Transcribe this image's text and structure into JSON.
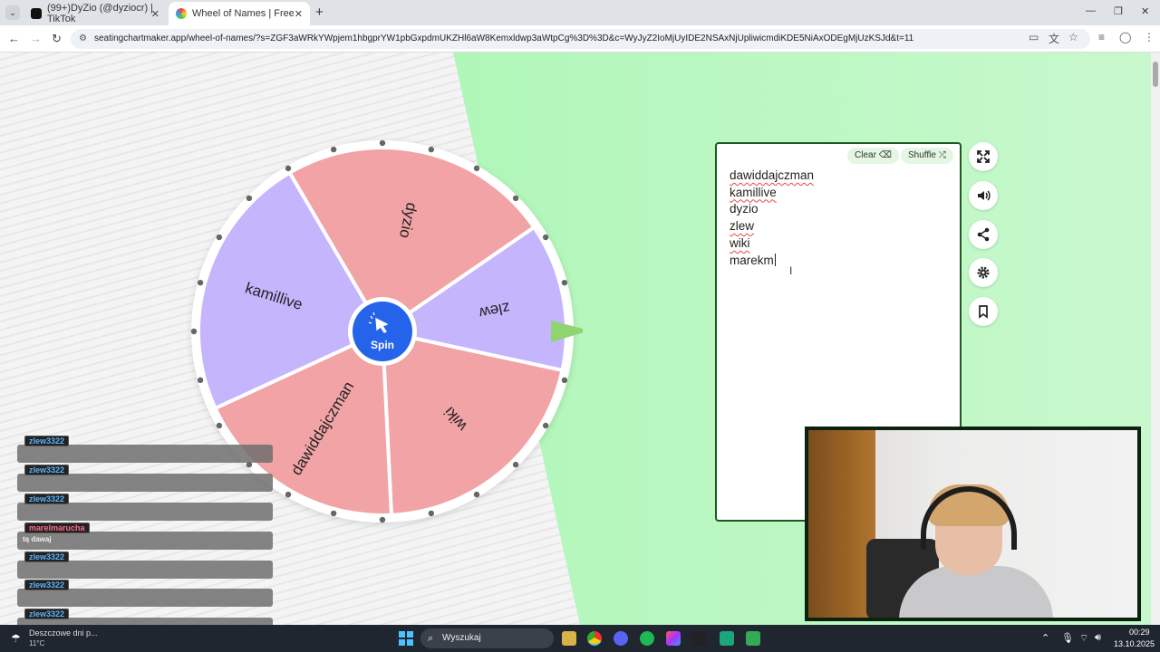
{
  "browser": {
    "tabs": [
      {
        "title": "(99+)DyZio (@dyziocr) | TikTok",
        "active": false
      },
      {
        "title": "Wheel of Names | Free & Ad-fr",
        "active": true
      }
    ],
    "new_tab": "+",
    "url": "seatingchartmaker.app/wheel-of-names/?s=ZGF3aWRkYWpjem1hbgprYW1pbGxpdmUKZHl6aW8Kemxldwp3aWtpCg%3D%3D&c=WyJyZ2IoMjUyIDE2NSAxNjUpliwicmdiKDE5NiAxODEgMjUzKSJd&t=11",
    "window_controls": [
      "minimize-icon",
      "restore-icon",
      "close-icon"
    ]
  },
  "wheel": {
    "segments": [
      {
        "label": "dyzio",
        "color": "#f1a3a6"
      },
      {
        "label": "zlew",
        "color": "#c4b5fd"
      },
      {
        "label": "wiki",
        "color": "#f1a3a6"
      },
      {
        "label": "dawiddajczman",
        "color": "#f1a3a6"
      },
      {
        "label": "kamillive",
        "color": "#c4b5fd"
      }
    ],
    "spin_label": "Spin",
    "spin_color": "#2563eb",
    "pointer_color": "#8fd46f"
  },
  "panel": {
    "clear_label": "Clear",
    "shuffle_label": "Shuffle",
    "names": [
      "dawiddajczman",
      "kamillive",
      "dyzio",
      "zlew",
      "wiki",
      "marekm"
    ]
  },
  "side_buttons": [
    "expand-icon",
    "volume-icon",
    "share-icon",
    "settings-icon",
    "bookmark-icon"
  ],
  "chat": [
    {
      "user": "zlew3322",
      "message": "",
      "user_color": "#5ab4ff"
    },
    {
      "user": "zlew3322",
      "message": "",
      "user_color": "#5ab4ff"
    },
    {
      "user": "zlew3322",
      "message": "",
      "user_color": "#5ab4ff"
    },
    {
      "user": "marelmarucha",
      "message": "tą dawaj",
      "user_color": "#ff6b8a"
    },
    {
      "user": "zlew3322",
      "message": "",
      "user_color": "#5ab4ff"
    },
    {
      "user": "zlew3322",
      "message": "",
      "user_color": "#5ab4ff"
    },
    {
      "user": "zlew3322",
      "message": "",
      "user_color": "#5ab4ff"
    }
  ],
  "taskbar": {
    "weather_text": "Deszczowe dni p...",
    "temperature": "11°C",
    "search_placeholder": "Wyszukaj",
    "time": "00:29",
    "date": "13.10.2025"
  }
}
